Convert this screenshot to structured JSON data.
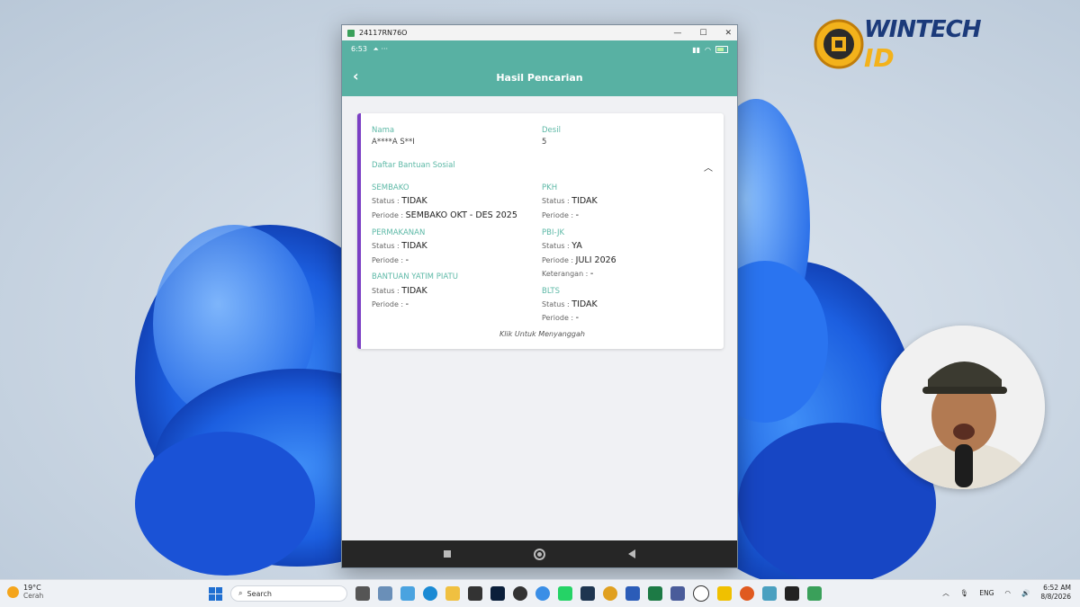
{
  "window": {
    "title": "24117RN76O",
    "controls": {
      "minimize": "—",
      "maximize": "☐",
      "close": "✕"
    }
  },
  "status_bar": {
    "time": "6:53",
    "extra": "⏶ ···"
  },
  "app_bar": {
    "title": "Hasil Pencarian",
    "back_icon": "back-chevron-icon"
  },
  "card": {
    "nama_label": "Nama",
    "nama_value": "A****A S**I",
    "desil_label": "Desil",
    "desil_value": "5",
    "section_label": "Daftar Bantuan Sosial",
    "programs_left": [
      {
        "name": "SEMBAKO",
        "status_prefix": "Status : ",
        "status": "TIDAK",
        "periode_prefix": "Periode : ",
        "periode": "SEMBAKO OKT - DES 2025"
      },
      {
        "name": "PERMAKANAN",
        "status_prefix": "Status : ",
        "status": "TIDAK",
        "periode_prefix": "Periode : ",
        "periode": "-"
      },
      {
        "name": "BANTUAN YATIM PIATU",
        "status_prefix": "Status : ",
        "status": "TIDAK",
        "periode_prefix": "Periode : ",
        "periode": "-"
      }
    ],
    "programs_right": [
      {
        "name": "PKH",
        "status_prefix": "Status : ",
        "status": "TIDAK",
        "periode_prefix": "Periode : ",
        "periode": "-"
      },
      {
        "name": "PBI-JK",
        "status_prefix": "Status : ",
        "status": "YA",
        "periode_prefix": "Periode : ",
        "periode": "JULI 2026",
        "keterangan_prefix": "Keterangan : ",
        "keterangan": "-"
      },
      {
        "name": "BLTS",
        "status_prefix": "Status : ",
        "status": "TIDAK",
        "periode_prefix": "Periode : ",
        "periode": "-"
      }
    ],
    "dispute_link": "Klik Untuk Menyanggah"
  },
  "logo": {
    "text_top": "WINTECH",
    "text_bottom": "ID"
  },
  "taskbar": {
    "weather_temp": "19°C",
    "weather_desc": "Cerah",
    "search_placeholder": "Search",
    "lang": "ENG",
    "time": "6:52 AM",
    "date": "8/8/2026"
  }
}
